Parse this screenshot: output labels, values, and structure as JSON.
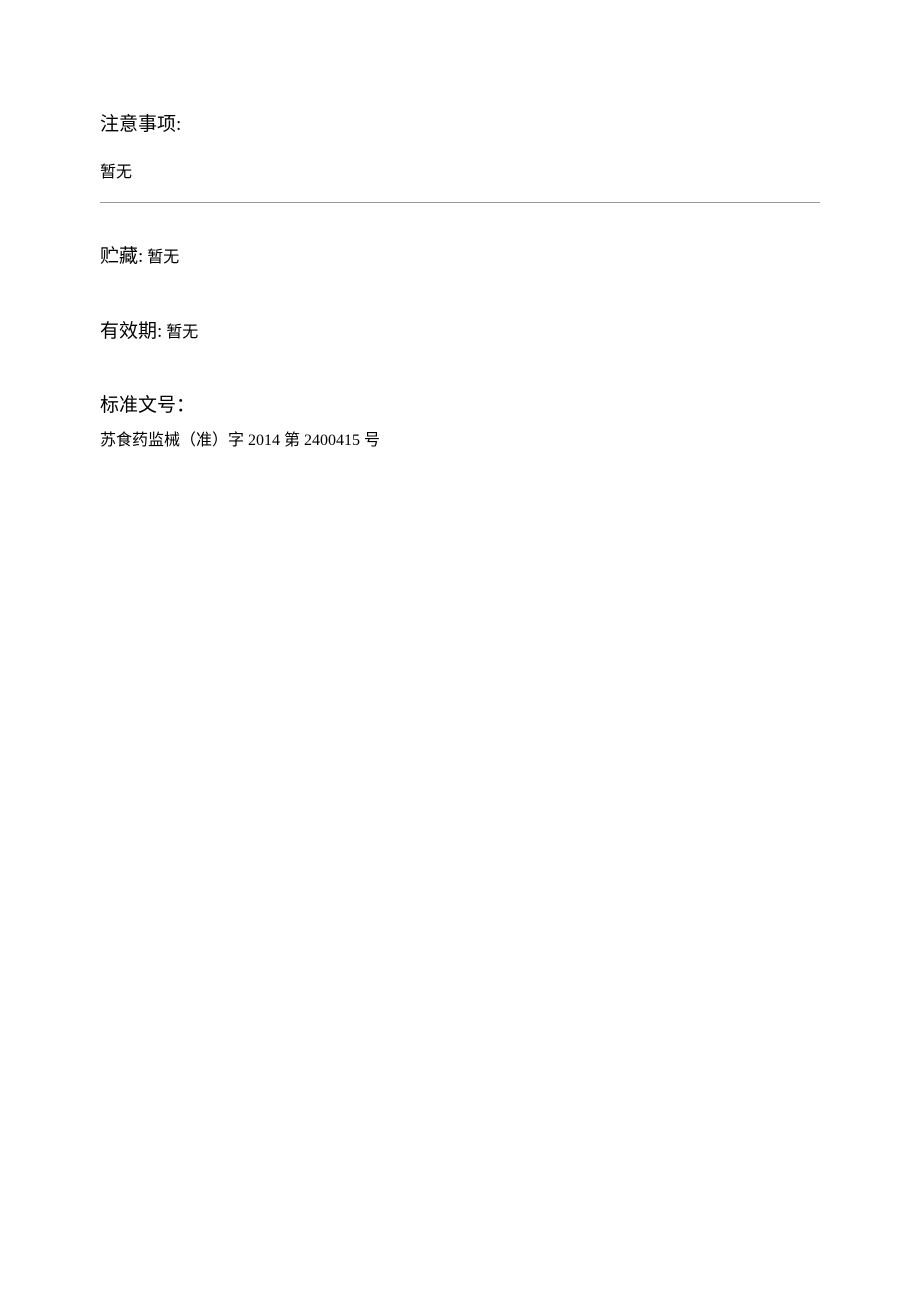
{
  "notes": {
    "label": "注意事项:",
    "value": "暂无"
  },
  "storage": {
    "label": "贮藏:",
    "value": "暂无"
  },
  "validity": {
    "label": "有效期:",
    "value": "暂无"
  },
  "standard": {
    "label": "标准文号：",
    "value": "苏食药监械（准）字 2014 第 2400415 号"
  }
}
